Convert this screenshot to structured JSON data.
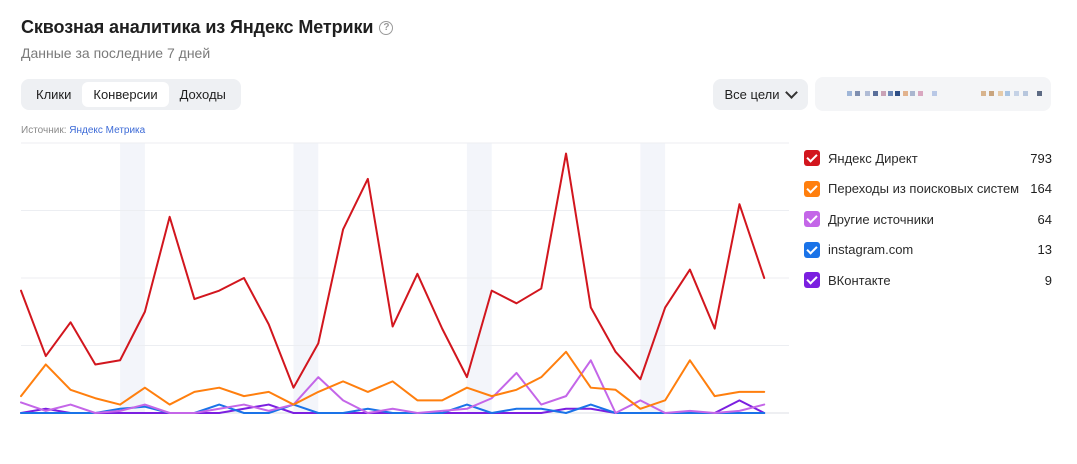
{
  "header": {
    "title": "Сквозная аналитика из Яндекс Метрики",
    "subtitle": "Данные за последние 7 дней"
  },
  "tabs": [
    {
      "label": "Клики",
      "active": false
    },
    {
      "label": "Конверсии",
      "active": true
    },
    {
      "label": "Доходы",
      "active": false
    }
  ],
  "goals_select": {
    "value": "Все цели"
  },
  "source": {
    "prefix": "Источник:",
    "link": "Яндекс Метрика"
  },
  "legend": [
    {
      "name": "Яндекс Директ",
      "value": "793",
      "color": "#d2161e"
    },
    {
      "name": "Переходы из поисковых систем",
      "value": "164",
      "color": "#ff7f0e"
    },
    {
      "name": "Другие источники",
      "value": "64",
      "color": "#c466e8"
    },
    {
      "name": "instagram.com",
      "value": "13",
      "color": "#1a73e8"
    },
    {
      "name": "ВКонтакте",
      "value": "9",
      "color": "#7b1fe0"
    }
  ],
  "chart_data": {
    "type": "line",
    "x": [
      1,
      2,
      3,
      4,
      5,
      6,
      7,
      8,
      9,
      10,
      11,
      12,
      13,
      14,
      15,
      16,
      17,
      18,
      19,
      20,
      21,
      22,
      23,
      24,
      25,
      26,
      27,
      28,
      29,
      30,
      31,
      32
    ],
    "ylim": [
      0,
      64
    ],
    "grid": true,
    "shaded_bands": [
      [
        5,
        6
      ],
      [
        12,
        13
      ],
      [
        19,
        20
      ],
      [
        26,
        27
      ]
    ],
    "series": [
      {
        "name": "Яндекс Директ",
        "color": "#d2161e",
        "values": [
          29,
          13.5,
          21.5,
          11.5,
          12.5,
          24,
          46.5,
          27,
          29,
          32,
          21,
          6,
          16.5,
          43.5,
          55.5,
          20.5,
          33,
          20,
          8.5,
          29,
          26,
          29.5,
          61.5,
          25,
          14.5,
          8,
          25,
          34,
          20,
          49.5,
          32
        ]
      },
      {
        "name": "Переходы из поисковых систем",
        "color": "#ff7f0e",
        "values": [
          4,
          11.5,
          5.5,
          3.5,
          2,
          6,
          2,
          5,
          6,
          4,
          5,
          2,
          5,
          7.5,
          5,
          7.5,
          3,
          3,
          6,
          4,
          5.5,
          8.5,
          14.5,
          6,
          5.5,
          1,
          3,
          12.5,
          4,
          5,
          5
        ]
      },
      {
        "name": "Другие источники",
        "color": "#c466e8",
        "values": [
          2.5,
          0.5,
          2,
          0,
          0.5,
          2,
          0,
          0,
          1,
          2,
          0.5,
          2,
          8.5,
          3,
          0,
          1,
          0,
          0.5,
          1,
          3.5,
          9.5,
          2,
          4,
          12.5,
          0,
          3,
          0,
          0.5,
          0,
          0.5,
          2
        ]
      },
      {
        "name": "instagram.com",
        "color": "#1a73e8",
        "values": [
          0,
          0,
          0,
          0,
          1,
          1.5,
          0,
          0,
          2,
          0,
          0,
          2,
          0,
          0,
          1,
          0,
          0,
          0,
          2,
          0,
          1,
          1,
          0,
          2,
          0,
          0,
          0,
          0,
          0,
          0,
          0
        ]
      },
      {
        "name": "ВКонтакте",
        "color": "#7b1fe0",
        "values": [
          0,
          1,
          0,
          0,
          0,
          0,
          0,
          0,
          0,
          1,
          2,
          0,
          0,
          0,
          0,
          0,
          0,
          0,
          0,
          0,
          0,
          0,
          1,
          1,
          0,
          0,
          0,
          0,
          0,
          3,
          0
        ]
      }
    ]
  }
}
